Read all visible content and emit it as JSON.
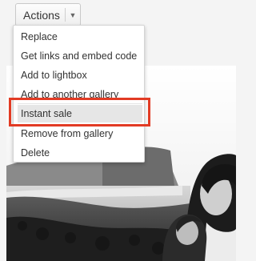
{
  "actions_button": {
    "label": "Actions",
    "caret_icon": "caret-down-icon"
  },
  "menu": {
    "items": [
      {
        "label": "Replace"
      },
      {
        "label": "Get links and embed code"
      },
      {
        "label": "Add to lightbox"
      },
      {
        "label": "Add to another gallery"
      },
      {
        "label": "Instant sale",
        "highlighted": true
      },
      {
        "label": "Remove from gallery"
      },
      {
        "label": "Delete"
      }
    ]
  },
  "annotation": {
    "color": "#e23b24"
  }
}
